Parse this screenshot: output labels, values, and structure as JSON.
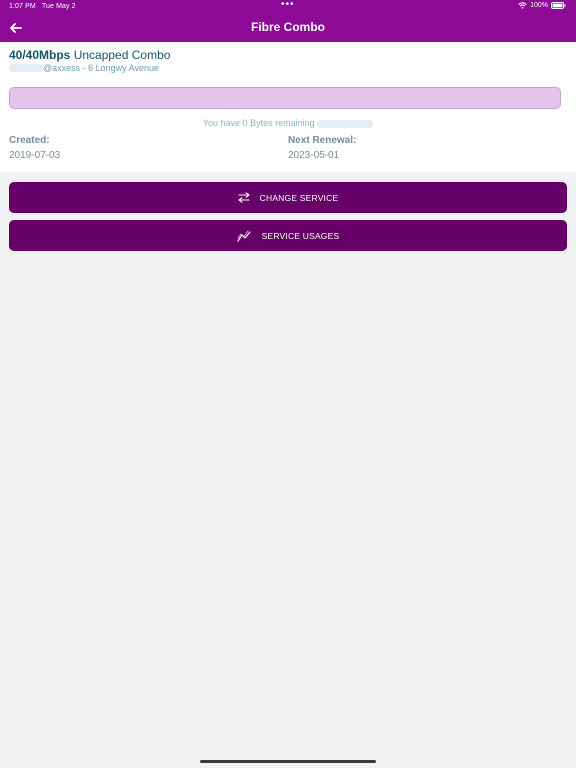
{
  "status_bar": {
    "time": "1:07 PM",
    "date": "Tue May 2",
    "dots": "•••",
    "battery": "100%"
  },
  "header": {
    "title": "Fibre Combo"
  },
  "service": {
    "speed": "40/40Mbps",
    "plan": " Uncapped Combo",
    "account_suffix": "@axxess - 6 Longwy Avenue",
    "remaining_text": "You have 0 Bytes remaining",
    "created_label": "Created:",
    "created_value": "2019-07-03",
    "renewal_label": "Next Renewal:",
    "renewal_value": "2023-05-01"
  },
  "actions": {
    "change_service": "CHANGE SERVICE",
    "service_usages": "SERVICE USAGES"
  },
  "colors": {
    "header_bg": "#8c0a96",
    "button_bg": "#660066",
    "bar_fill": "#e5c4ec",
    "text_dark": "#16566b"
  }
}
